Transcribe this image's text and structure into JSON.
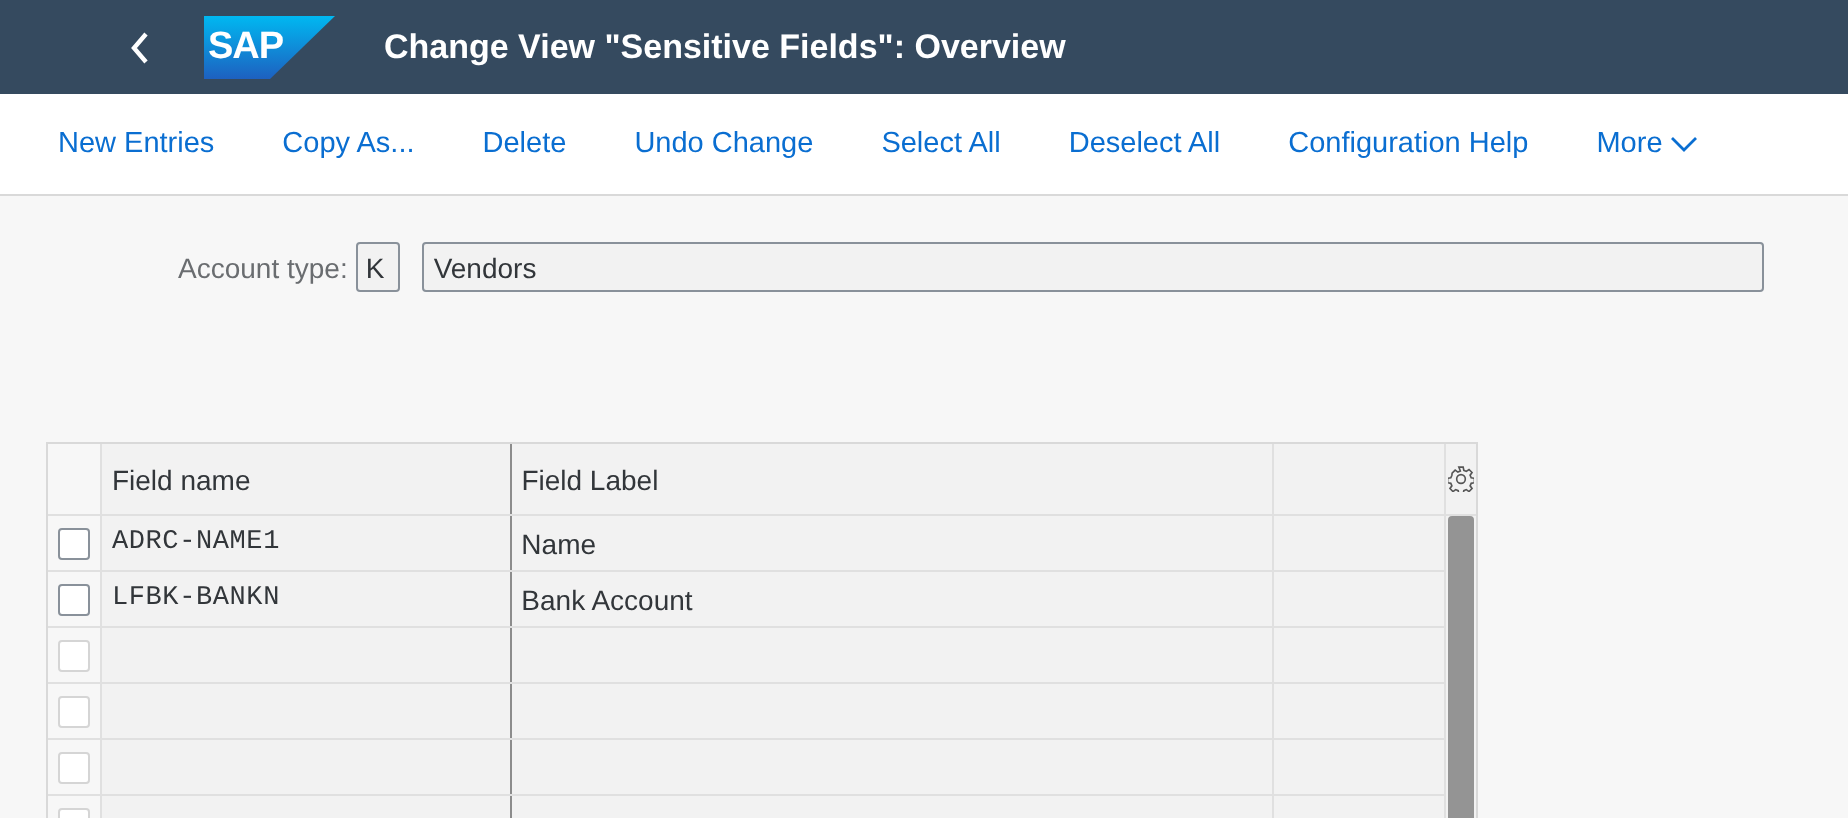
{
  "header": {
    "title": "Change View \"Sensitive Fields\": Overview",
    "logo": "SAP"
  },
  "toolbar": [
    "New Entries",
    "Copy As...",
    "Delete",
    "Undo Change",
    "Select All",
    "Deselect All",
    "Configuration Help",
    "More"
  ],
  "account_type": {
    "label": "Account type:",
    "code": "K",
    "description": "Vendors"
  },
  "table": {
    "columns": [
      "Field name",
      "Field Label"
    ],
    "rows": [
      {
        "field_name": "ADRC-NAME1",
        "field_label": "Name",
        "checked": false,
        "disabled": false
      },
      {
        "field_name": "LFBK-BANKN",
        "field_label": "Bank Account",
        "checked": false,
        "disabled": false
      },
      {
        "checked": false,
        "disabled": true
      },
      {
        "checked": false,
        "disabled": true
      },
      {
        "checked": false,
        "disabled": true
      },
      {
        "checked": false,
        "disabled": true
      }
    ]
  }
}
